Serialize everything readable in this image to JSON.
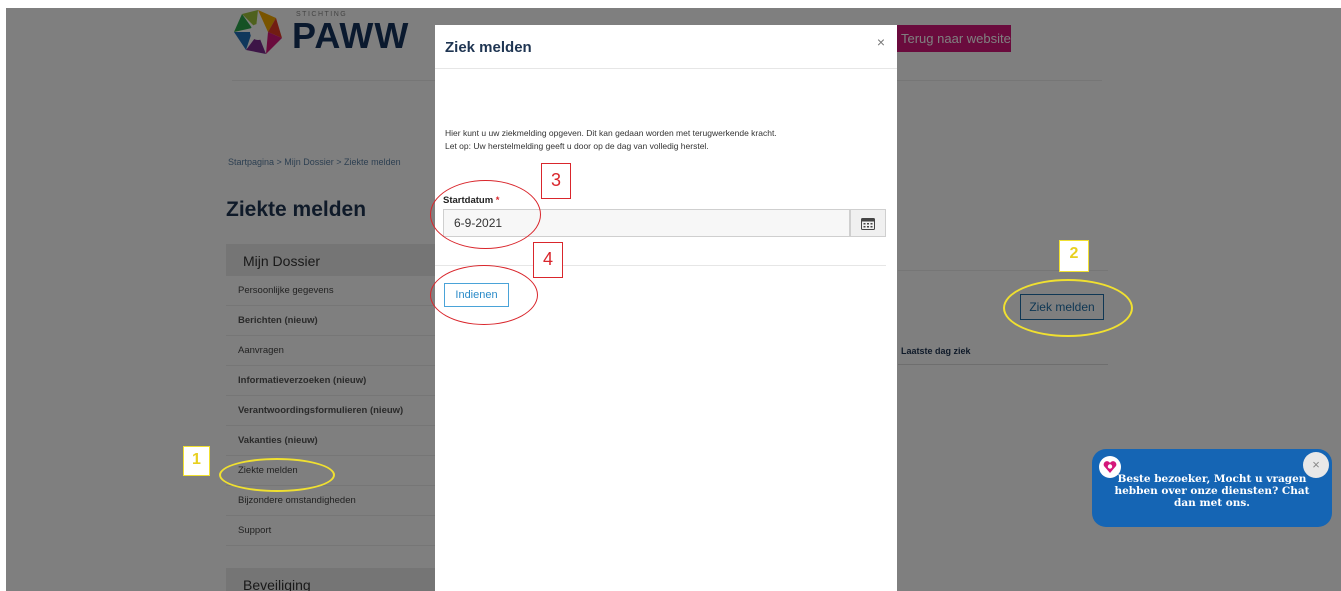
{
  "site": {
    "logo_small": "STICHTING",
    "logo_big": "PAWW",
    "back_button": "Terug naar website",
    "breadcrumb": "Startpagina  >  Mijn Dossier  >  Ziekte melden",
    "page_title": "Ziekte melden"
  },
  "sidebar": {
    "heading": "Mijn Dossier",
    "items": [
      {
        "label": "Persoonlijke gegevens"
      },
      {
        "label": "Berichten (nieuw)"
      },
      {
        "label": "Aanvragen"
      },
      {
        "label": "Informatieverzoeken (nieuw)"
      },
      {
        "label": "Verantwoordingsformulieren (nieuw)"
      },
      {
        "label": "Vakanties (nieuw)"
      },
      {
        "label": "Ziekte melden"
      },
      {
        "label": "Bijzondere omstandigheden"
      },
      {
        "label": "Support"
      }
    ],
    "heading2": "Beveiliging"
  },
  "main": {
    "ziek_button": "Ziek melden",
    "column_header": "Laatste dag ziek"
  },
  "modal": {
    "title": "Ziek melden",
    "close": "×",
    "intro_line1": "Hier kunt u uw ziekmelding opgeven. Dit kan gedaan worden met terugwerkende kracht.",
    "intro_line2": "Let op: Uw herstelmelding geeft u door op de dag van volledig herstel.",
    "field_label": "Startdatum",
    "required_mark": "*",
    "date_value": "6-9-2021",
    "submit": "Indienen"
  },
  "chat": {
    "message": "Beste bezoeker, Mocht u vragen hebben over onze diensten? Chat dan met ons.",
    "close": "×"
  },
  "annotations": {
    "a1": "1",
    "a2": "2",
    "a3": "3",
    "a4": "4"
  },
  "colors": {
    "brand_navy": "#14325c",
    "brand_pink": "#d4177b",
    "chat_blue": "#1565b4",
    "annot_yellow": "#f0e030",
    "annot_red": "#d9262c"
  }
}
